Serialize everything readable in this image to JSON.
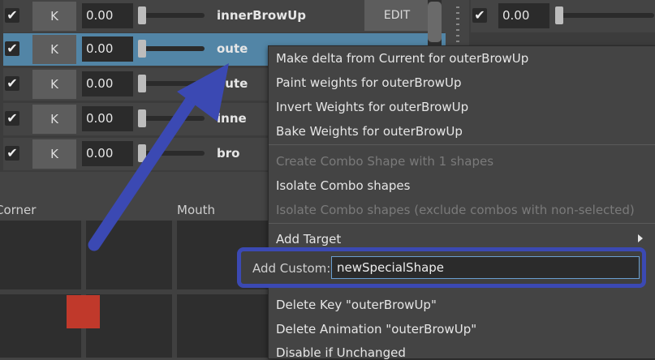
{
  "rows": [
    {
      "checked": true,
      "key_label": "K",
      "value": "0.00",
      "name": "innerBrowUp"
    },
    {
      "checked": true,
      "key_label": "K",
      "value": "0.00",
      "name": "oute"
    },
    {
      "checked": true,
      "key_label": "K",
      "value": "0.00",
      "name": "oute"
    },
    {
      "checked": true,
      "key_label": "K",
      "value": "0.00",
      "name": "inne"
    },
    {
      "checked": true,
      "key_label": "K",
      "value": "0.00",
      "name": "bro"
    }
  ],
  "edit_button": "EDIT",
  "right_row": {
    "value": "0.00"
  },
  "check_glyph": "✔",
  "sections": {
    "corner": "Corner",
    "mouth": "Mouth"
  },
  "menu": {
    "items": [
      {
        "label": "Make delta from Current for outerBrowUp",
        "enabled": true
      },
      {
        "label": "Paint weights for outerBrowUp",
        "enabled": true
      },
      {
        "label": "Invert Weights for outerBrowUp",
        "enabled": true
      },
      {
        "label": "Bake Weights for outerBrowUp",
        "enabled": true
      },
      {
        "label": "Create Combo Shape with 1 shapes",
        "enabled": false
      },
      {
        "label": "Isolate Combo shapes",
        "enabled": true
      },
      {
        "label": "Isolate Combo shapes (exclude combos with non-selected)",
        "enabled": false
      },
      {
        "label": "Add Target",
        "enabled": true,
        "submenu": true
      },
      {
        "label": "Delete Key \"outerBrowUp\"",
        "enabled": true
      },
      {
        "label": "Delete Animation \"outerBrowUp\"",
        "enabled": true
      },
      {
        "label": "Disable if Unchanged",
        "enabled": true
      }
    ],
    "add_custom": {
      "label": "Add Custom:",
      "value": "newSpecialShape"
    }
  },
  "colors": {
    "selected_row": "#5285a6",
    "annotation_blue": "#3b49b3",
    "marker_red": "#c0392b"
  }
}
